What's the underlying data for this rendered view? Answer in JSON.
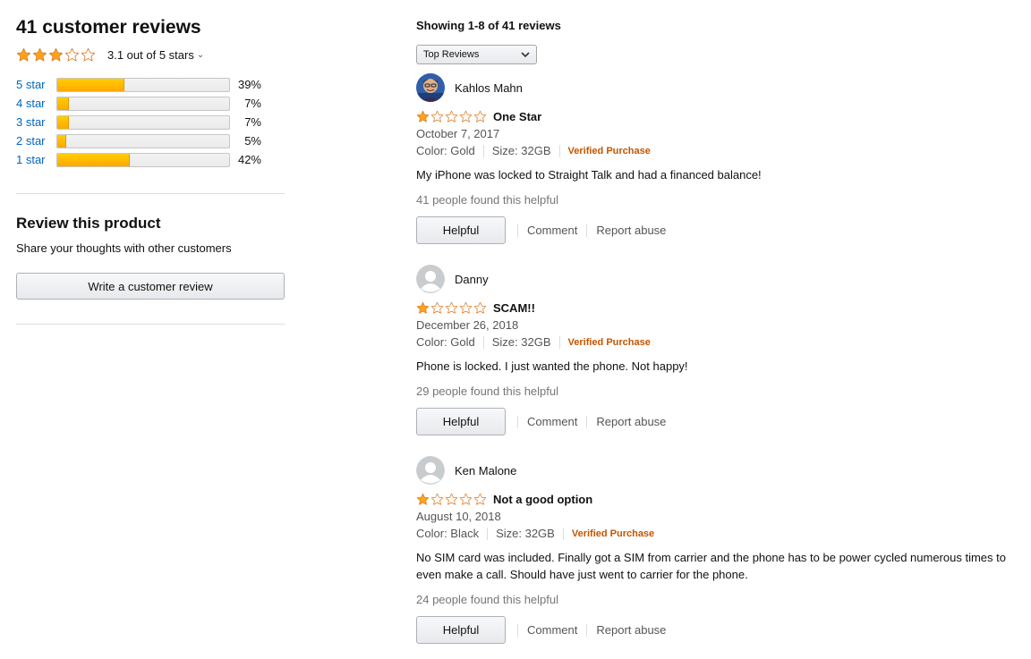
{
  "summary": {
    "title": "41 customer reviews",
    "avg_rating": 3.1,
    "avg_text": "3.1 out of 5 stars",
    "histogram": [
      {
        "label": "5 star",
        "pct_text": "39%",
        "pct": 0.39
      },
      {
        "label": "4 star",
        "pct_text": "7%",
        "pct": 0.07
      },
      {
        "label": "3 star",
        "pct_text": "7%",
        "pct": 0.07
      },
      {
        "label": "2 star",
        "pct_text": "5%",
        "pct": 0.05
      },
      {
        "label": "1 star",
        "pct_text": "42%",
        "pct": 0.42
      }
    ]
  },
  "review_product": {
    "heading": "Review this product",
    "subtext": "Share your thoughts with other customers",
    "button_label": "Write a customer review"
  },
  "list": {
    "showing": "Showing 1-8 of 41 reviews",
    "sort_selected": "Top Reviews"
  },
  "reviews": [
    {
      "name": "Kahlos Mahn",
      "avatar": "profile-photo",
      "rating": 1,
      "title": "One Star",
      "date": "October 7, 2017",
      "color": "Color: Gold",
      "size": "Size: 32GB",
      "verified": "Verified Purchase",
      "body": "My iPhone was locked to Straight Talk and had a financed balance!",
      "helpful_count": "41 people found this helpful",
      "helpful_label": "Helpful",
      "comment_label": "Comment",
      "report_label": "Report abuse"
    },
    {
      "name": "Danny",
      "avatar": "default-avatar",
      "rating": 1,
      "title": "SCAM!!",
      "date": "December 26, 2018",
      "color": "Color: Gold",
      "size": "Size: 32GB",
      "verified": "Verified Purchase",
      "body": "Phone is locked. I just wanted the phone. Not happy!",
      "helpful_count": "29 people found this helpful",
      "helpful_label": "Helpful",
      "comment_label": "Comment",
      "report_label": "Report abuse"
    },
    {
      "name": "Ken Malone",
      "avatar": "default-avatar",
      "rating": 1,
      "title": "Not a good option",
      "date": "August 10, 2018",
      "color": "Color: Black",
      "size": "Size: 32GB",
      "verified": "Verified Purchase",
      "body": "No SIM card was included. Finally got a SIM from carrier and the phone has to be power cycled numerous times to even make a call. Should have just went to carrier for the phone.",
      "helpful_count": "24 people found this helpful",
      "helpful_label": "Helpful",
      "comment_label": "Comment",
      "report_label": "Report abuse"
    }
  ],
  "colors": {
    "star": "#ffa41c",
    "link": "#0066c0",
    "verified": "#c45500"
  }
}
